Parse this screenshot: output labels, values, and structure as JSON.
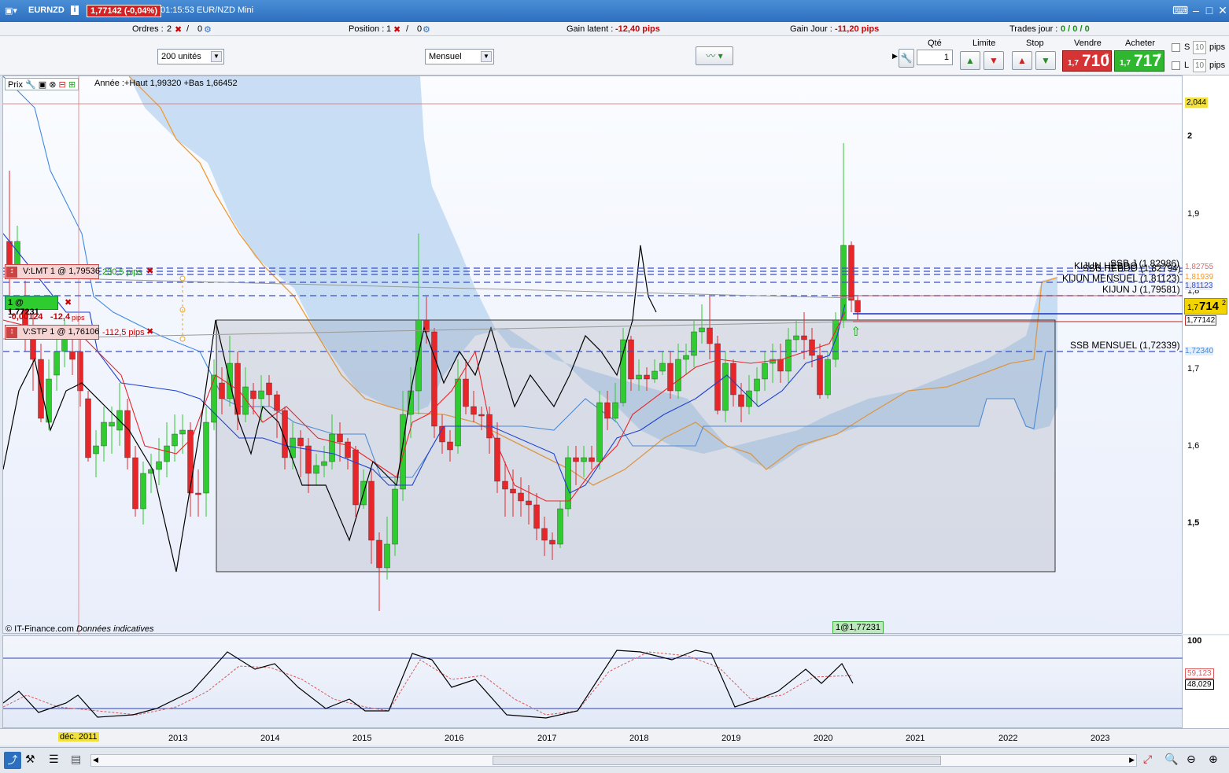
{
  "window": {
    "symbol": "EURNZD",
    "price_badge": "1,77142 (-0,04%)",
    "time": "01:15:53",
    "name": "EUR/NZD Mini"
  },
  "info": {
    "orders_label": "Ordres :",
    "orders_count": "2",
    "orders_sep": "/",
    "orders_pending": "0",
    "position_label": "Position :",
    "position_count": "1",
    "position_sep": "/",
    "position_pending": "0",
    "gain_latent_label": "Gain latent :",
    "gain_latent_value": "-12,40 pips",
    "gain_jour_label": "Gain Jour :",
    "gain_jour_value": "-11,20 pips",
    "trades_label": "Trades jour :",
    "trades_value": "0 / 0 / 0"
  },
  "toolbar": {
    "units": "200 unités",
    "period": "Mensuel",
    "qty_label": "Qté",
    "qty_value": "1",
    "limit_label": "Limite",
    "stop_label": "Stop",
    "sell_label": "Vendre",
    "buy_label": "Acheter",
    "sell_small": "1,7",
    "sell_big": "710",
    "sell_sup": "7",
    "buy_small": "1,7",
    "buy_big": "717",
    "buy_sup": "7",
    "s_label": "S",
    "l_label": "L",
    "s_pips": "10",
    "l_pips": "10",
    "pips": "pips"
  },
  "chart": {
    "prix_label": "Prix",
    "header": "Année :+Haut 1,99320 +Bas 1,66452",
    "copyright": "© IT-Finance.com",
    "disclaimer": "Données indicatives",
    "position_tag": "1@1,77231"
  },
  "orders": {
    "lmt_label": "V:LMT  1 @ 1,79536",
    "lmt_pips": "230,5 pips",
    "pos_label": "1 @ 1,77231",
    "pos_diff": "-0,00124",
    "pos_pips": "-12,4",
    "pos_unit": "pips",
    "stp_label": "V:STP  1 @ 1,76106",
    "stp_pips": "-112,5 pips"
  },
  "lines": {
    "ssb_j": "SSB J (1,82986)",
    "ssb_hebdo": "SSB HEBDO (1,82794)",
    "kijun_hebdo": "KIJUN HEBDO",
    "kijun_mensuel": "KIJUN MENSUEL (1,81123)",
    "kijun_j": "KIJUN J (1,79581)",
    "ssb_mensuel": "SSB MENSUEL (1,72339)"
  },
  "price_axis": {
    "ticks": [
      "2",
      "1,9",
      "1,8",
      "1,7",
      "1,6",
      "1,5"
    ],
    "top_box": "2,044",
    "box1": "1,82755",
    "box2": "1,81939",
    "box3": "1,81123",
    "cur_small": "1,7",
    "cur_big": "714",
    "cur_sup": "2",
    "box4": "1,77142",
    "box5": "1,72340"
  },
  "osc_axis": {
    "top": "100",
    "v1": "59,123",
    "v2": "48,029"
  },
  "time_axis": {
    "labels": [
      "déc. 2011",
      "2013",
      "2014",
      "2015",
      "2016",
      "2017",
      "2018",
      "2019",
      "2020",
      "2021",
      "2022",
      "2023"
    ]
  },
  "colors": {
    "bull": "#2ecc2e",
    "bear": "#e8262a",
    "tenkan": "#e8262a",
    "kijun": "#2040d0",
    "chikou": "#000000",
    "ssa": "#f29a2e",
    "cloud": "#b8d4f0"
  }
}
